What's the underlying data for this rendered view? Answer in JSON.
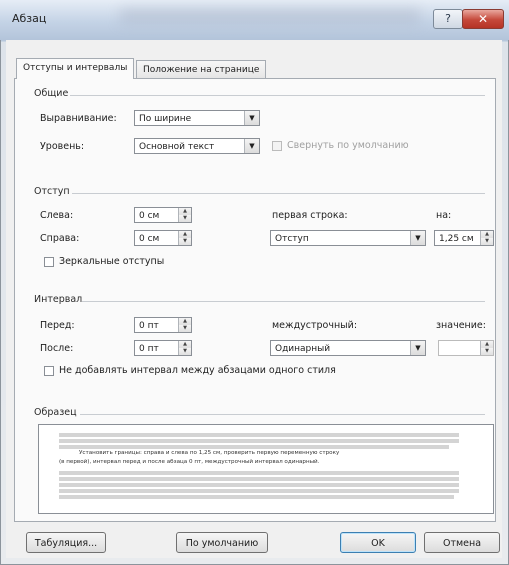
{
  "window": {
    "title": "Абзац",
    "help_glyph": "?",
    "close_glyph": "✕"
  },
  "tabs": [
    {
      "label": "Отступы и интервалы",
      "active": true
    },
    {
      "label": "Положение на странице",
      "active": false
    }
  ],
  "general": {
    "heading": "Общие",
    "alignment_label": "Выравнивание:",
    "alignment_value": "По ширине",
    "level_label": "Уровень:",
    "level_value": "Основной текст",
    "collapse_label": "Свернуть по умолчанию"
  },
  "indent": {
    "heading": "Отступ",
    "left_label": "Слева:",
    "left_value": "0 см",
    "right_label": "Справа:",
    "right_value": "0 см",
    "first_line_label": "первая строка:",
    "first_line_value": "Отступ",
    "by_label": "на:",
    "by_value": "1,25 см",
    "mirror_label": "Зеркальные отступы"
  },
  "spacing": {
    "heading": "Интервал",
    "before_label": "Перед:",
    "before_value": "0 пт",
    "after_label": "После:",
    "after_value": "0 пт",
    "line_spacing_label": "междустрочный:",
    "line_spacing_value": "Одинарный",
    "value_label": "значение:",
    "value_value": "",
    "no_space_label": "Не добавлять интервал между абзацами одного стиля"
  },
  "preview": {
    "heading": "Образец",
    "sample_line_1": "Установить границы: справа и слева по 1,25 см, проверить первую переменную строку",
    "sample_line_2": "(в первой), интервал перед и после абзаца 0 пт, междустрочный интервал одинарный."
  },
  "buttons": {
    "tabs": "Табуляция...",
    "default": "По умолчанию",
    "ok": "OK",
    "cancel": "Отмена"
  },
  "icons": {
    "dropdown": "▼",
    "spin_up": "▲",
    "spin_down": "▼"
  }
}
